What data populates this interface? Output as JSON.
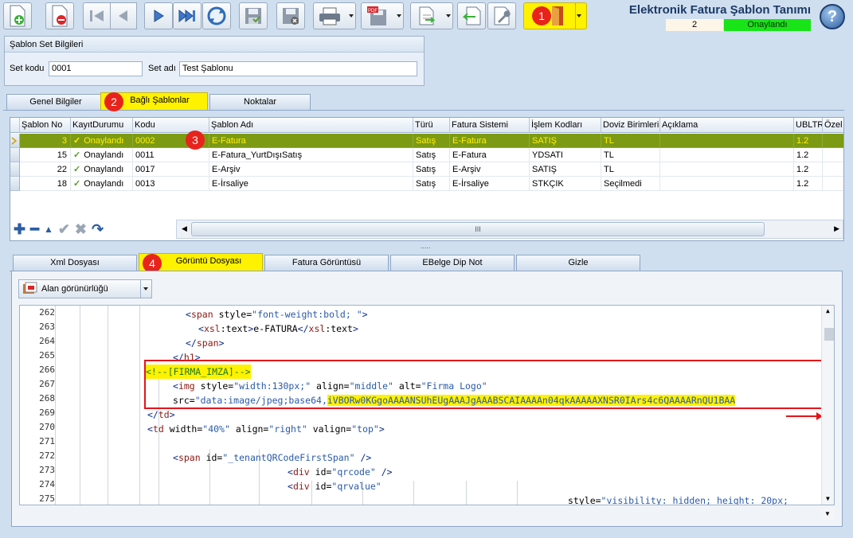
{
  "window_title": "Elektronik Fatura Şablon Tanımı",
  "record_count": "2",
  "record_status": "Onaylandı",
  "help_label": "?",
  "toolbar": {
    "items": [
      {
        "name": "new-record-button",
        "icon": "add-document-icon"
      },
      {
        "name": "delete-record-button",
        "icon": "delete-document-icon"
      },
      {
        "name": "first-record-button",
        "icon": "first-icon"
      },
      {
        "name": "previous-record-button",
        "icon": "previous-icon"
      },
      {
        "name": "next-record-button",
        "icon": "next-icon"
      },
      {
        "name": "last-record-button",
        "icon": "last-icon"
      },
      {
        "name": "refresh-button",
        "icon": "refresh-icon"
      },
      {
        "name": "save-button",
        "icon": "save-icon"
      },
      {
        "name": "cancel-save-button",
        "icon": "save-cancel-icon"
      },
      {
        "name": "print-button",
        "icon": "printer-icon"
      },
      {
        "name": "pdf-export-button",
        "icon": "pdf-icon"
      },
      {
        "name": "import-export-button",
        "icon": "export-icon"
      },
      {
        "name": "import-button",
        "icon": "import-icon"
      },
      {
        "name": "tools-button",
        "icon": "wrench-icon"
      },
      {
        "name": "exit-button",
        "icon": "exit-door-icon"
      }
    ],
    "accent": "#fff200"
  },
  "annotations": {
    "badge1": "1",
    "badge2": "2",
    "badge3": "3",
    "badge4": "4"
  },
  "set_info": {
    "header": "Şablon Set Bilgileri",
    "code_label": "Set kodu",
    "code_value": "0001",
    "name_label": "Set adı",
    "name_value": "Test Şablonu"
  },
  "tabs": [
    "Genel Bilgiler",
    "Bağlı Şablonlar",
    "Noktalar"
  ],
  "grid": {
    "columns": [
      "Şablon No",
      "KayıtDurumu",
      "Kodu",
      "Şablon Adı",
      "Türü",
      "Fatura Sistemi",
      "İşlem Kodları",
      "Doviz Birimleri",
      "Açıklama",
      "UBLTR",
      "Özel F"
    ],
    "rows": [
      {
        "no": "3",
        "status": "Onaylandı",
        "code": "0002",
        "name": "E-Fatura",
        "type": "Satış",
        "system": "E-Fatura",
        "ops": "SATIŞ",
        "currency": "TL",
        "desc": "",
        "ubl": "1.2"
      },
      {
        "no": "15",
        "status": "Onaylandı",
        "code": "0011",
        "name": "E-Fatura_YurtDışıSatış",
        "type": "Satış",
        "system": "E-Fatura",
        "ops": "YDSATI",
        "currency": "TL",
        "desc": "",
        "ubl": "1.2"
      },
      {
        "no": "22",
        "status": "Onaylandı",
        "code": "0017",
        "name": "E-Arşiv",
        "type": "Satış",
        "system": "E-Arşiv",
        "ops": "SATIŞ",
        "currency": "TL",
        "desc": "",
        "ubl": "1.2"
      },
      {
        "no": "18",
        "status": "Onaylandı",
        "code": "0013",
        "name": "E-İrsaliye",
        "type": "Satış",
        "system": "E-İrsaliye",
        "ops": "STKÇIK",
        "currency": "Seçilmedi",
        "desc": "",
        "ubl": "1.2"
      }
    ],
    "selected_row": 0,
    "navigator_icons": [
      "add-icon",
      "remove-icon",
      "up-icon",
      "check-icon",
      "cancel-icon",
      "undo-icon"
    ],
    "scroll_label": "III",
    "splitter": "....."
  },
  "sub_tabs": [
    "Xml Dosyası",
    "Görüntü Dosyası",
    "Fatura Görüntüsü",
    "EBelge Dip Not",
    "Gizle"
  ],
  "visibility_button": "Alan görünürlüğü",
  "code": {
    "lines": [
      {
        "n": "262",
        "t": "<span style=\"font-weight:bold; \">"
      },
      {
        "n": "263",
        "t": "<xsl:text>e-FATURA</xsl:text>"
      },
      {
        "n": "264",
        "t": "</span>"
      },
      {
        "n": "265",
        "t": "</h1>"
      },
      {
        "n": "266",
        "t": "<!--[FIRMA_IMZA]-->"
      },
      {
        "n": "267",
        "t": "<img style=\"width:130px;\" align=\"middle\" alt=\"Firma Logo\""
      },
      {
        "n": "268",
        "t": "src=\"data:image/jpeg;base64,iVBORw0KGgoAAAANSUhEUgAAAJgAAABSCAIAAAAn04qkAAAAAXNSR0IArs4c6QAAAARnQU1BAA"
      },
      {
        "n": "269",
        "t": "</td>"
      },
      {
        "n": "270",
        "t": "<td width=\"40%\" align=\"right\" valign=\"top\">"
      },
      {
        "n": "271",
        "t": ""
      },
      {
        "n": "272",
        "t": "<span id=\"_tenantQRCodeFirstSpan\" />"
      },
      {
        "n": "273",
        "t": "<div id=\"qrcode\" />"
      },
      {
        "n": "274",
        "t": "<div id=\"qrvalue\""
      },
      {
        "n": "275",
        "t": "style=\"visibility: hidden; height: 20px;"
      }
    ]
  }
}
